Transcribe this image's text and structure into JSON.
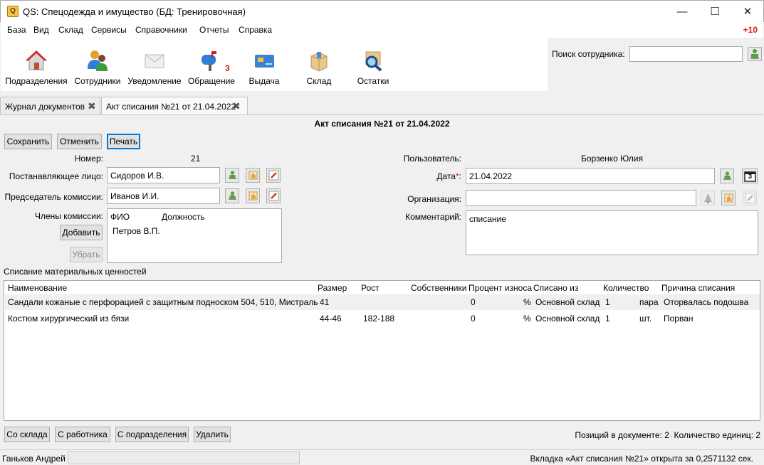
{
  "window": {
    "title": "QS: Спецодежда и имущество (БД: Тренировочная)",
    "min_glyph": "—",
    "max_glyph": "☐",
    "close_glyph": "✕"
  },
  "menu": {
    "items": [
      "База",
      "Вид",
      "Склад",
      "Сервисы",
      "Справочники",
      "Отчеты",
      "Справка"
    ],
    "badge": "+10"
  },
  "toolbar": {
    "buttons": [
      {
        "label": "Подразделения",
        "icon": "house-icon"
      },
      {
        "label": "Сотрудники",
        "icon": "people-icon"
      },
      {
        "label": "Уведомление",
        "icon": "envelope-icon"
      },
      {
        "label": "Обращение",
        "icon": "mailbox-icon"
      },
      {
        "label": "Выдача",
        "icon": "card-icon"
      },
      {
        "label": "Склад",
        "icon": "box-icon"
      },
      {
        "label": "Остатки",
        "icon": "magnifier-icon"
      }
    ],
    "obrashenie_count": "3"
  },
  "search": {
    "label": "Поиск сотрудника:",
    "value": ""
  },
  "tabs": [
    {
      "label": "Журнал документов",
      "active": false
    },
    {
      "label": "Акт списания №21 от 21.04.2022",
      "active": true
    }
  ],
  "document": {
    "title": "Акт списания №21 от 21.04.2022",
    "actions": {
      "save": "Сохранить",
      "cancel": "Отменить",
      "print": "Печать"
    },
    "number_label": "Номер:",
    "number": "21",
    "user_label": "Пользователь:",
    "user": "Борзенко Юлия",
    "issuer_label": "Постанавляющее лицо:",
    "issuer": "Сидоров И.В.",
    "date_label": "Дата",
    "date_required": "*",
    "date_colon": ":",
    "date": "21.04.2022",
    "chairman_label": "Председатель комиссии:",
    "chairman": "Иванов И.И.",
    "org_label": "Организация:",
    "org": "",
    "members_label": "Члены комиссии:",
    "members_cols": {
      "fio": "ФИО",
      "position": "Должность"
    },
    "members": [
      {
        "fio": "Петров В.П.",
        "position": ""
      }
    ],
    "add_btn": "Добавить",
    "remove_btn": "Убрать",
    "comment_label": "Комментарий:",
    "comment": "списание",
    "calendar_glyph": "3"
  },
  "writeoff": {
    "section_title": "Списание материальных ценностей",
    "columns": [
      "Наименование",
      "Размер",
      "Рост",
      "Собственники",
      "Процент износа",
      "Списано из",
      "Количество",
      "Причина списания"
    ],
    "rows": [
      {
        "name": "Сандали кожаные с перфорацией с защитным подноском 504, 510, Мистраль",
        "size": "41",
        "height": "",
        "owners": "",
        "wear": "0",
        "pct": "%",
        "from": "Основной склад",
        "qty": "1",
        "unit": "пара",
        "reason": "Оторвалась подошва"
      },
      {
        "name": "Костюм хирургический из бязи",
        "size": "44-46",
        "height": "182-188",
        "owners": "",
        "wear": "0",
        "pct": "%",
        "from": "Основной склад",
        "qty": "1",
        "unit": "шт.",
        "reason": "Порван"
      }
    ],
    "buttons": {
      "from_stock": "Со склада",
      "from_worker": "С работника",
      "from_dept": "С подразделения",
      "delete": "Удалить"
    },
    "summary": "Позиций в документе: 2  Количество единиц: 2"
  },
  "status": {
    "user": "Ганьков Андрей",
    "message": "Вкладка «Акт списания №21» открыта за 0,2571132 сек."
  }
}
